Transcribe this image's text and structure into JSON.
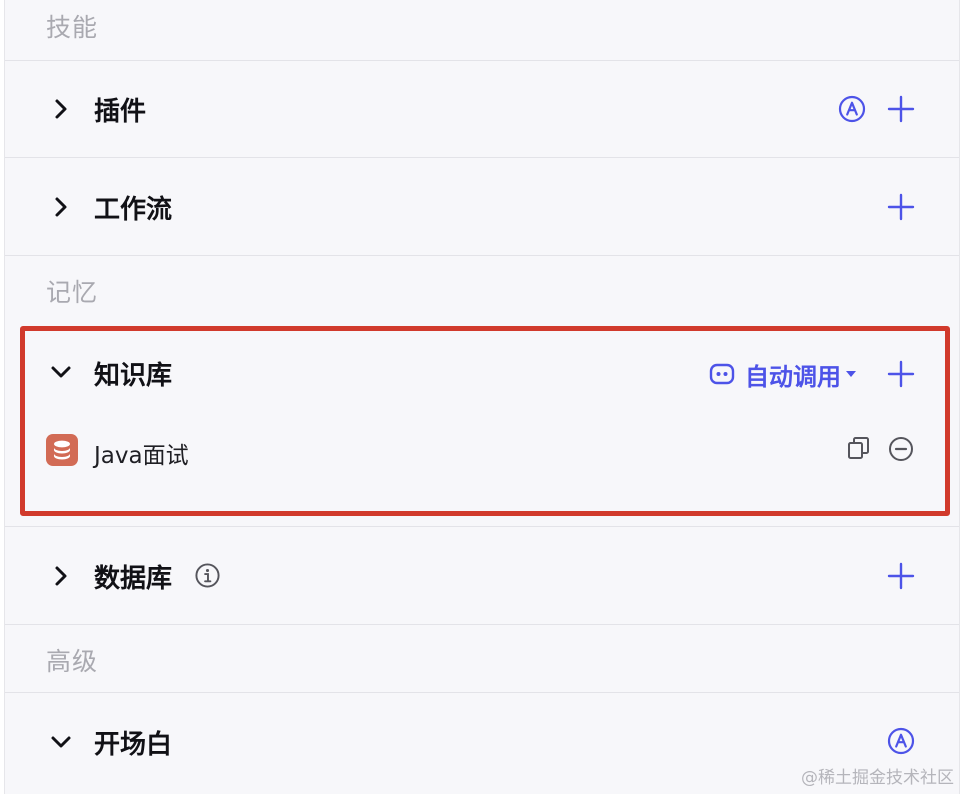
{
  "skills": {
    "title": "技能",
    "plugins": {
      "label": "插件",
      "auto_icon": "circle-a-icon",
      "add_icon": "plus-icon"
    },
    "workflow": {
      "label": "工作流",
      "add_icon": "plus-icon"
    }
  },
  "memory": {
    "title": "记忆",
    "knowledge": {
      "label": "知识库",
      "auto_call_label": "自动调用",
      "items": [
        {
          "name": "Java面试",
          "icon": "database-icon"
        }
      ]
    },
    "database": {
      "label": "数据库",
      "info_icon": "info-icon"
    }
  },
  "advanced": {
    "title": "高级",
    "opening": {
      "label": "开场白",
      "auto_icon": "circle-a-icon"
    }
  },
  "watermark": "@稀土掘金技术社区",
  "colors": {
    "accent": "#4d53e8",
    "highlight_border": "#d13a2c",
    "db_icon_bg": "#d26b55",
    "muted_text": "#a9a9b0"
  }
}
